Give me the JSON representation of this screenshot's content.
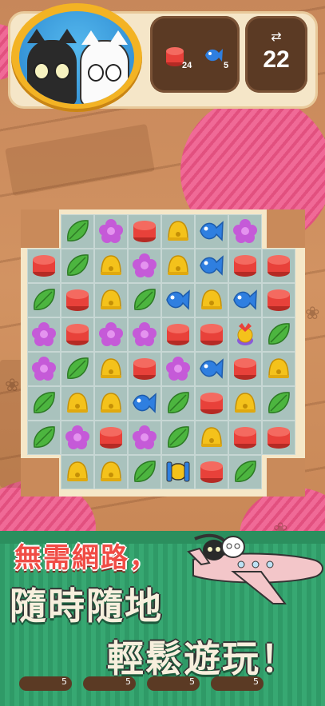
{
  "hud": {
    "goals": [
      {
        "icon": "red-cylinder-icon",
        "count": "24"
      },
      {
        "icon": "blue-fish-icon",
        "count": "5"
      }
    ],
    "moves_icon": "swap-arrows-icon",
    "moves": "22"
  },
  "board": {
    "rows": [
      [
        "",
        "leaf",
        "flower",
        "cyl",
        "bell",
        "fish",
        "flower",
        ""
      ],
      [
        "cyl",
        "leaf",
        "bell",
        "flower",
        "bell",
        "fish",
        "cyl",
        "cyl"
      ],
      [
        "leaf",
        "cyl",
        "bell",
        "leaf",
        "fish",
        "bell",
        "fish",
        "cyl"
      ],
      [
        "flower",
        "cyl",
        "flower",
        "flower",
        "cyl",
        "cyl",
        "gift",
        "leaf"
      ],
      [
        "flower",
        "leaf",
        "bell",
        "cyl",
        "flower",
        "fish",
        "cyl",
        "bell"
      ],
      [
        "leaf",
        "bell",
        "bell",
        "fish",
        "leaf",
        "cyl",
        "bell",
        "leaf"
      ],
      [
        "leaf",
        "flower",
        "cyl",
        "flower",
        "leaf",
        "bell",
        "cyl",
        "cyl"
      ],
      [
        "",
        "bell",
        "bell",
        "leaf",
        "rocket",
        "cyl",
        "leaf",
        ""
      ]
    ]
  },
  "banner": {
    "line1": "無需網路，",
    "line2": "隨時隨地",
    "line3": "輕鬆遊玩！"
  },
  "bottom_bar": [
    "5",
    "5",
    "5",
    "5"
  ],
  "colors": {
    "cyl": "#e8413a",
    "leaf": "#4cb53f",
    "flower": "#c55ad8",
    "bell": "#f4c21b",
    "fish": "#2f7fe0",
    "banner": "#2f9a67"
  }
}
